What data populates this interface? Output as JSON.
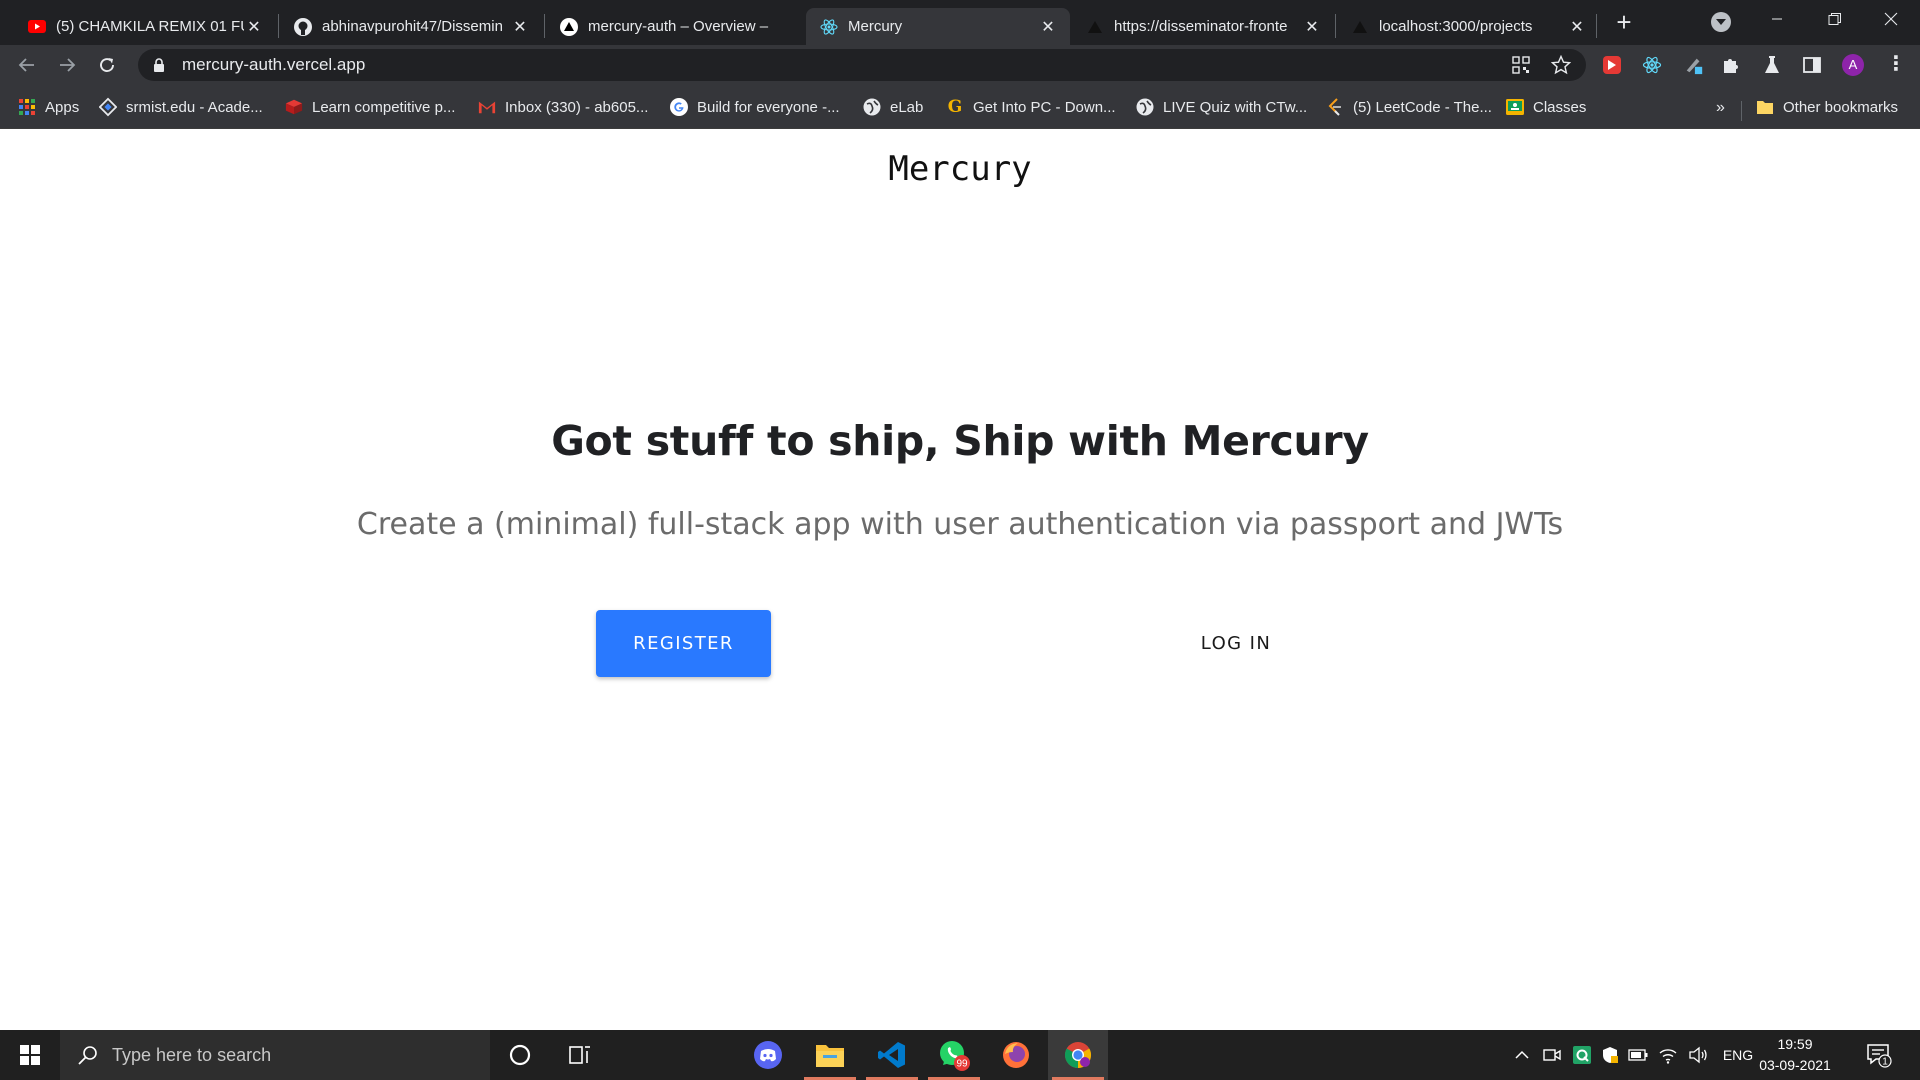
{
  "browser": {
    "tabs": [
      {
        "title": "(5) CHAMKILA REMIX 01 FU",
        "favicon": "youtube-icon",
        "active": false
      },
      {
        "title": "abhinavpurohit47/Dissemin",
        "favicon": "github-icon",
        "active": false
      },
      {
        "title": "mercury-auth – Overview –",
        "favicon": "vercel-icon",
        "active": false
      },
      {
        "title": "Mercury",
        "favicon": "react-icon",
        "active": true
      },
      {
        "title": "https://disseminator-fronte",
        "favicon": "vercel-icon",
        "active": false
      },
      {
        "title": "localhost:3000/projects",
        "favicon": "vercel-icon",
        "active": false
      }
    ],
    "address_bar": {
      "url": "mercury-auth.vercel.app",
      "secure": true
    },
    "bookmarks": [
      {
        "label": "Apps",
        "icon": "apps-grid-icon"
      },
      {
        "label": "srmist.edu - Acade...",
        "icon": "srmist-icon"
      },
      {
        "label": "Learn competitive p...",
        "icon": "cube-icon"
      },
      {
        "label": "Inbox (330) - ab605...",
        "icon": "gmail-icon"
      },
      {
        "label": "Build for everyone -...",
        "icon": "google-icon"
      },
      {
        "label": "eLab",
        "icon": "globe-icon"
      },
      {
        "label": "Get Into PC - Down...",
        "icon": "getintopc-icon"
      },
      {
        "label": "LIVE Quiz with CTw...",
        "icon": "globe-icon"
      },
      {
        "label": "(5) LeetCode - The...",
        "icon": "leetcode-icon"
      },
      {
        "label": "Classes",
        "icon": "classroom-icon"
      }
    ],
    "bookmarks_overflow": "»",
    "other_bookmarks": "Other bookmarks",
    "profile_initial": "A",
    "colors": {
      "tabstrip": "#202124",
      "toolbar": "#35363a",
      "avatar": "#8e24aa"
    }
  },
  "page": {
    "brand": "Mercury",
    "hero_title": "Got stuff to ship, Ship with Mercury",
    "hero_subtitle": "Create a (minimal) full-stack app with user authentication via passport and JWTs",
    "register_label": "REGISTER",
    "login_label": "LOG IN",
    "colors": {
      "primary": "#2979ff"
    }
  },
  "taskbar": {
    "search_placeholder": "Type here to search",
    "whatsapp_badge": "99",
    "language": "ENG",
    "time": "19:59",
    "date": "03-09-2021",
    "notification_count": "1"
  }
}
